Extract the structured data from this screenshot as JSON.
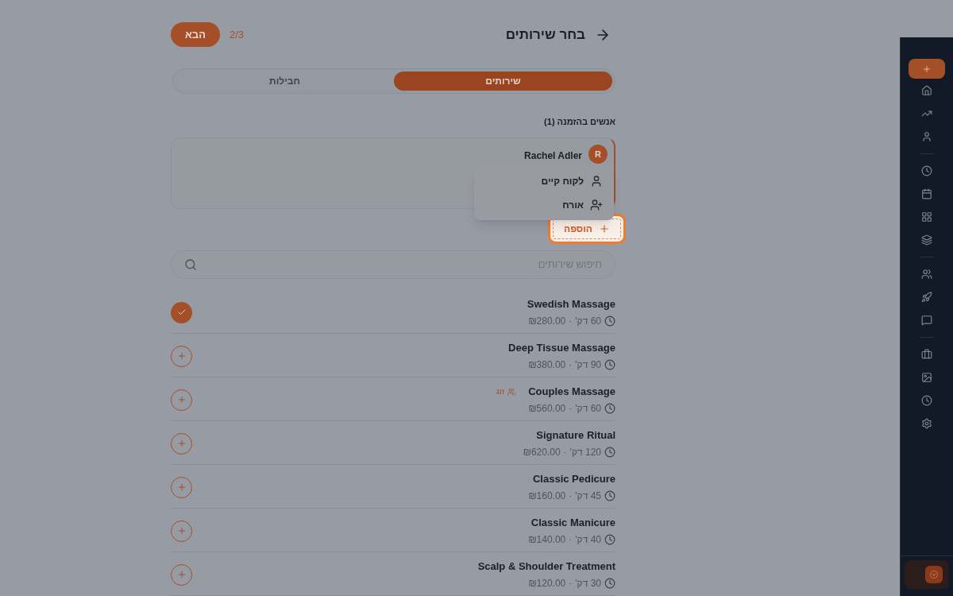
{
  "header": {
    "title": "בחר שירותים",
    "step": "2/3",
    "next_button": "הבא"
  },
  "tabs": [
    {
      "label": "שירותים",
      "selected": true
    },
    {
      "label": "חבילות",
      "selected": false
    }
  ],
  "people": {
    "heading": "אנשים בהזמנה (1)",
    "person": {
      "initial": "R",
      "name": "Rachel Adler"
    }
  },
  "add_menu": {
    "items": [
      {
        "kind": "existing",
        "label": "לקוח קיים"
      },
      {
        "kind": "guest",
        "label": "אורח"
      }
    ]
  },
  "add_button": "הוספה",
  "search": {
    "placeholder": "חיפוש שירותים"
  },
  "services": [
    {
      "name": "Swedish Massage",
      "duration": "60 דק'",
      "separator": "·",
      "price": "₪280.00",
      "selected": true
    },
    {
      "name": "Deep Tissue Massage",
      "duration": "90 דק'",
      "separator": "·",
      "price": "₪380.00",
      "selected": false
    },
    {
      "name": "Couples Massage",
      "duration": "60 דק'",
      "separator": "·",
      "price": "₪560.00",
      "selected": false,
      "tag": "זוג"
    },
    {
      "name": "Signature Ritual",
      "duration": "120 דק'",
      "separator": "·",
      "price": "₪620.00",
      "selected": false
    },
    {
      "name": "Classic Pedicure",
      "duration": "45 דק'",
      "separator": "·",
      "price": "₪160.00",
      "selected": false
    },
    {
      "name": "Classic Manicure",
      "duration": "40 דק'",
      "separator": "·",
      "price": "₪140.00",
      "selected": false
    },
    {
      "name": "Scalp & Shoulder Treatment",
      "duration": "30 דק'",
      "separator": "·",
      "price": "₪120.00",
      "selected": false
    }
  ]
}
